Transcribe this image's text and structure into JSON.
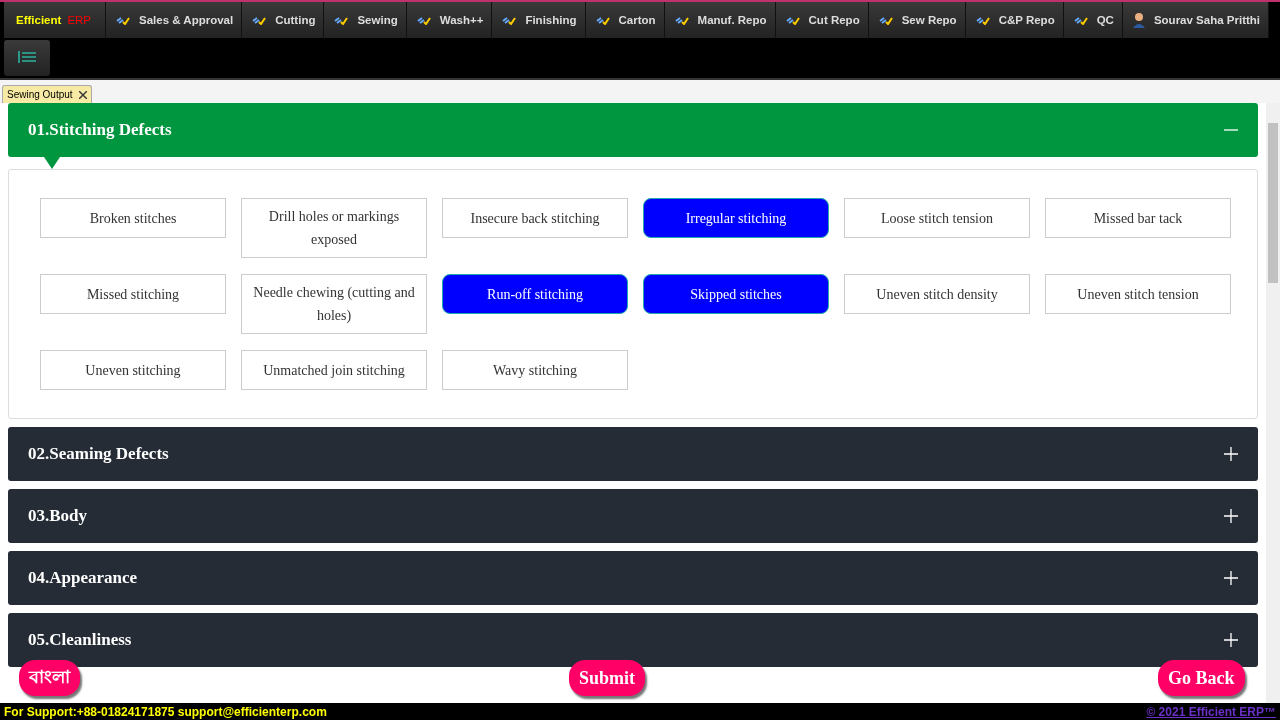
{
  "brand": {
    "first": "Efficient",
    "second": "ERP"
  },
  "nav": [
    {
      "label": "Sales & Approval"
    },
    {
      "label": "Cutting"
    },
    {
      "label": "Sewing"
    },
    {
      "label": "Wash++"
    },
    {
      "label": "Finishing"
    },
    {
      "label": "Carton"
    },
    {
      "label": "Manuf. Repo"
    },
    {
      "label": "Cut Repo"
    },
    {
      "label": "Sew Repo"
    },
    {
      "label": "C&P Repo"
    },
    {
      "label": "QC"
    }
  ],
  "user": {
    "name": "Sourav Saha Pritthi"
  },
  "doc_tabs": [
    {
      "label": "Sewing Output",
      "selected": true
    }
  ],
  "sections": [
    {
      "title": "01.Stitching Defects",
      "expanded": true,
      "defects": [
        {
          "label": "Broken stitches",
          "selected": false
        },
        {
          "label": "Drill holes or markings exposed",
          "selected": false
        },
        {
          "label": "Insecure back stitching",
          "selected": false
        },
        {
          "label": "Irregular stitching",
          "selected": true
        },
        {
          "label": "Loose stitch tension",
          "selected": false
        },
        {
          "label": "Missed bar tack",
          "selected": false
        },
        {
          "label": "Missed stitching",
          "selected": false
        },
        {
          "label": "Needle chewing (cutting and holes)",
          "selected": false
        },
        {
          "label": "Run-off stitching",
          "selected": true
        },
        {
          "label": "Skipped stitches",
          "selected": true
        },
        {
          "label": "Uneven stitch density",
          "selected": false
        },
        {
          "label": "Uneven stitch tension",
          "selected": false
        },
        {
          "label": "Uneven stitching",
          "selected": false
        },
        {
          "label": "Unmatched join stitching",
          "selected": false
        },
        {
          "label": "Wavy stitching",
          "selected": false
        }
      ]
    },
    {
      "title": "02.Seaming Defects",
      "expanded": false
    },
    {
      "title": "03.Body",
      "expanded": false
    },
    {
      "title": "04.Appearance",
      "expanded": false
    },
    {
      "title": "05.Cleanliness",
      "expanded": false
    }
  ],
  "actions": {
    "language": "বাংলা",
    "submit": "Submit",
    "back": "Go Back"
  },
  "footer": {
    "support": "For Support:+88-01824171875 support@efficienterp.com",
    "copyright": "© 2021 Efficient ERP™"
  }
}
